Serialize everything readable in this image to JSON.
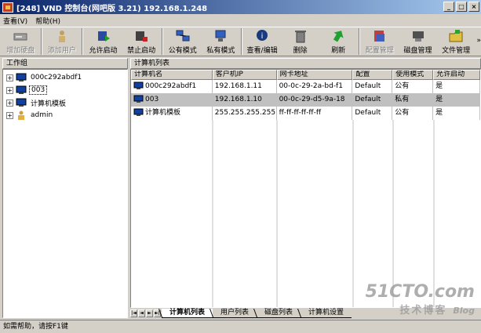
{
  "window": {
    "title": "[248] VND 控制台(网吧版 3.21) 192.168.1.248",
    "controls": [
      "_",
      "□",
      "×"
    ]
  },
  "menu": {
    "items": [
      "查看(V)",
      "帮助(H)"
    ]
  },
  "toolbar": {
    "buttons": [
      {
        "label": "增加硬盘",
        "icon": "add-disk-icon",
        "disabled": true
      },
      {
        "label": "添加用户",
        "icon": "add-user-icon",
        "disabled": true
      },
      {
        "label": "允许启动",
        "icon": "allow-boot-icon",
        "disabled": false
      },
      {
        "label": "禁止启动",
        "icon": "disable-boot-icon",
        "disabled": false
      },
      {
        "label": "公有模式",
        "icon": "public-mode-icon",
        "disabled": false
      },
      {
        "label": "私有模式",
        "icon": "private-mode-icon",
        "disabled": false
      },
      {
        "label": "查看/编辑",
        "icon": "view-edit-icon",
        "disabled": false
      },
      {
        "label": "删除",
        "icon": "delete-icon",
        "disabled": false
      },
      {
        "label": "刷新",
        "icon": "refresh-icon",
        "disabled": false
      },
      {
        "label": "配置管理",
        "icon": "config-icon",
        "disabled": true
      },
      {
        "label": "磁盘管理",
        "icon": "disk-manage-icon",
        "disabled": false
      },
      {
        "label": "文件管理",
        "icon": "file-manage-icon",
        "disabled": false
      }
    ],
    "more": "»"
  },
  "left_panel": {
    "header": "工作组",
    "tree": [
      {
        "label": "000c292abdf1",
        "icon": "computer-icon",
        "expander": "+",
        "selected": false
      },
      {
        "label": "003",
        "icon": "computer-icon",
        "expander": "+",
        "selected": true
      },
      {
        "label": "计算机模板",
        "icon": "computer-icon",
        "expander": "+",
        "selected": false
      },
      {
        "label": "admin",
        "icon": "user-icon",
        "expander": "+",
        "selected": false
      }
    ]
  },
  "right_panel": {
    "header": "计算机列表",
    "columns": [
      "计算机名",
      "客户机IP",
      "网卡地址",
      "配置",
      "使用模式",
      "允许启动"
    ],
    "rows": [
      {
        "name": "000c292abdf1",
        "ip": "192.168.1.11",
        "mac": "00-0c-29-2a-bd-f1",
        "config": "Default",
        "mode": "公有",
        "boot": "是",
        "selected": false
      },
      {
        "name": "003",
        "ip": "192.168.1.10",
        "mac": "00-0c-29-d5-9a-18",
        "config": "Default",
        "mode": "私有",
        "boot": "是",
        "selected": true
      },
      {
        "name": "计算机模板",
        "ip": "255.255.255.255",
        "mac": "ff-ff-ff-ff-ff-ff",
        "config": "Default",
        "mode": "公有",
        "boot": "是",
        "selected": false
      }
    ]
  },
  "tabs": [
    {
      "label": "计算机列表",
      "active": true
    },
    {
      "label": "用户列表",
      "active": false
    },
    {
      "label": "磁盘列表",
      "active": false
    },
    {
      "label": "计算机设置",
      "active": false
    }
  ],
  "statusbar": {
    "text": "如需帮助，请按F1键"
  },
  "watermark": {
    "logo": "51CTO.com",
    "sub": "技术博客",
    "blog": "Blog"
  }
}
